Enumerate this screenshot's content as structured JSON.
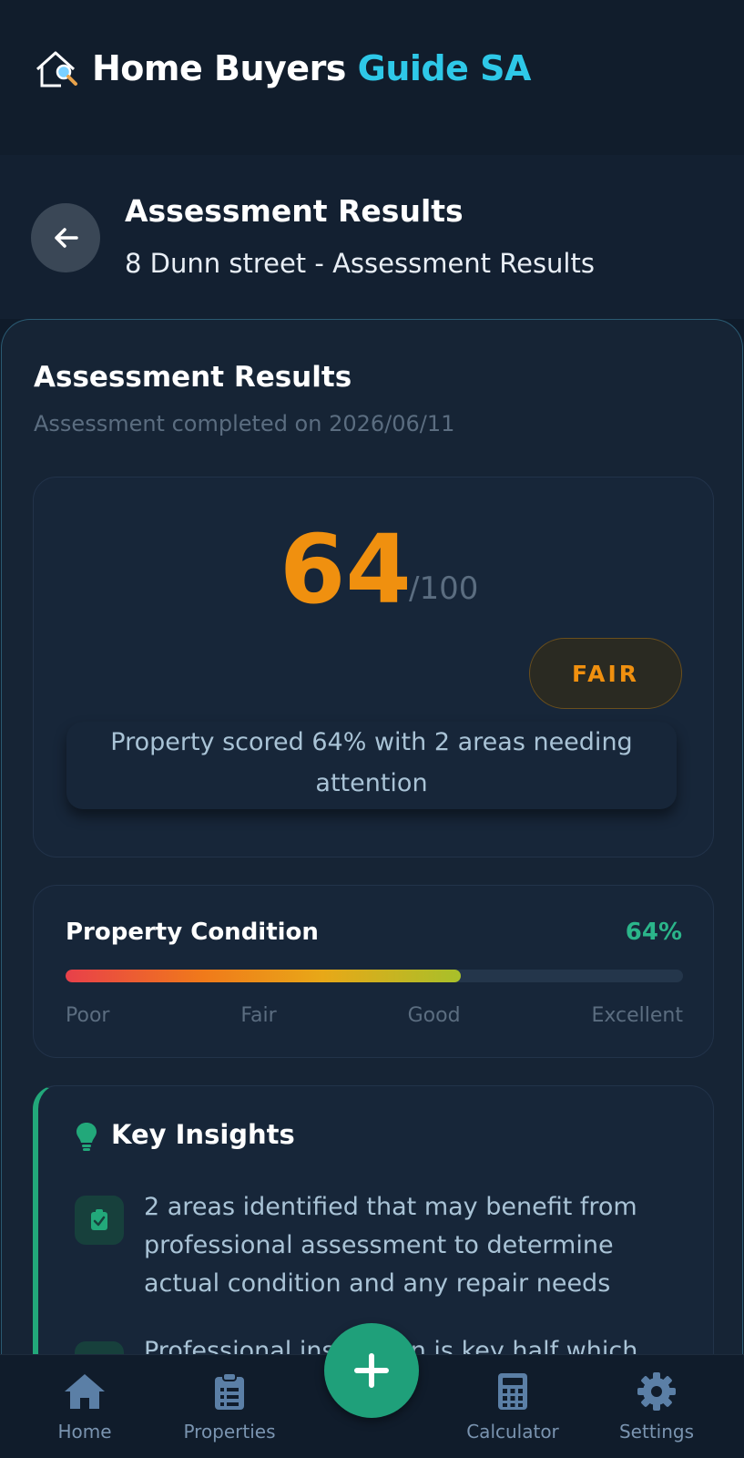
{
  "app": {
    "title_main": "Home Buyers ",
    "title_accent": "Guide SA"
  },
  "subheader": {
    "title": "Assessment Results",
    "subtitle": "8 Dunn street - Assessment Results"
  },
  "results": {
    "title": "Assessment Results",
    "completed": "Assessment completed on 2026/06/11",
    "score": "64",
    "score_max": "/100",
    "rating": "FAIR",
    "summary": "Property scored 64% with 2 areas needing attention"
  },
  "condition": {
    "title": "Property Condition",
    "percent_label": "64%",
    "fill_fraction": 0.64,
    "scale": [
      "Poor",
      "Fair",
      "Good",
      "Excellent"
    ]
  },
  "insights": {
    "title": "Key Insights",
    "items": [
      "2 areas identified that may benefit from professional assessment to determine actual condition and any repair needs",
      "Professional inspection is key half which"
    ]
  },
  "nav": {
    "items": [
      {
        "label": "Home",
        "icon": "home-icon"
      },
      {
        "label": "Properties",
        "icon": "clipboard-icon"
      },
      {
        "label": "Calculator",
        "icon": "calculator-icon"
      },
      {
        "label": "Settings",
        "icon": "gear-icon"
      }
    ],
    "fab_icon": "plus-icon"
  },
  "colors": {
    "accent": "#2ec8e8",
    "score": "#f0900f",
    "green": "#2bb58a",
    "bg": "#0f1b2a"
  }
}
